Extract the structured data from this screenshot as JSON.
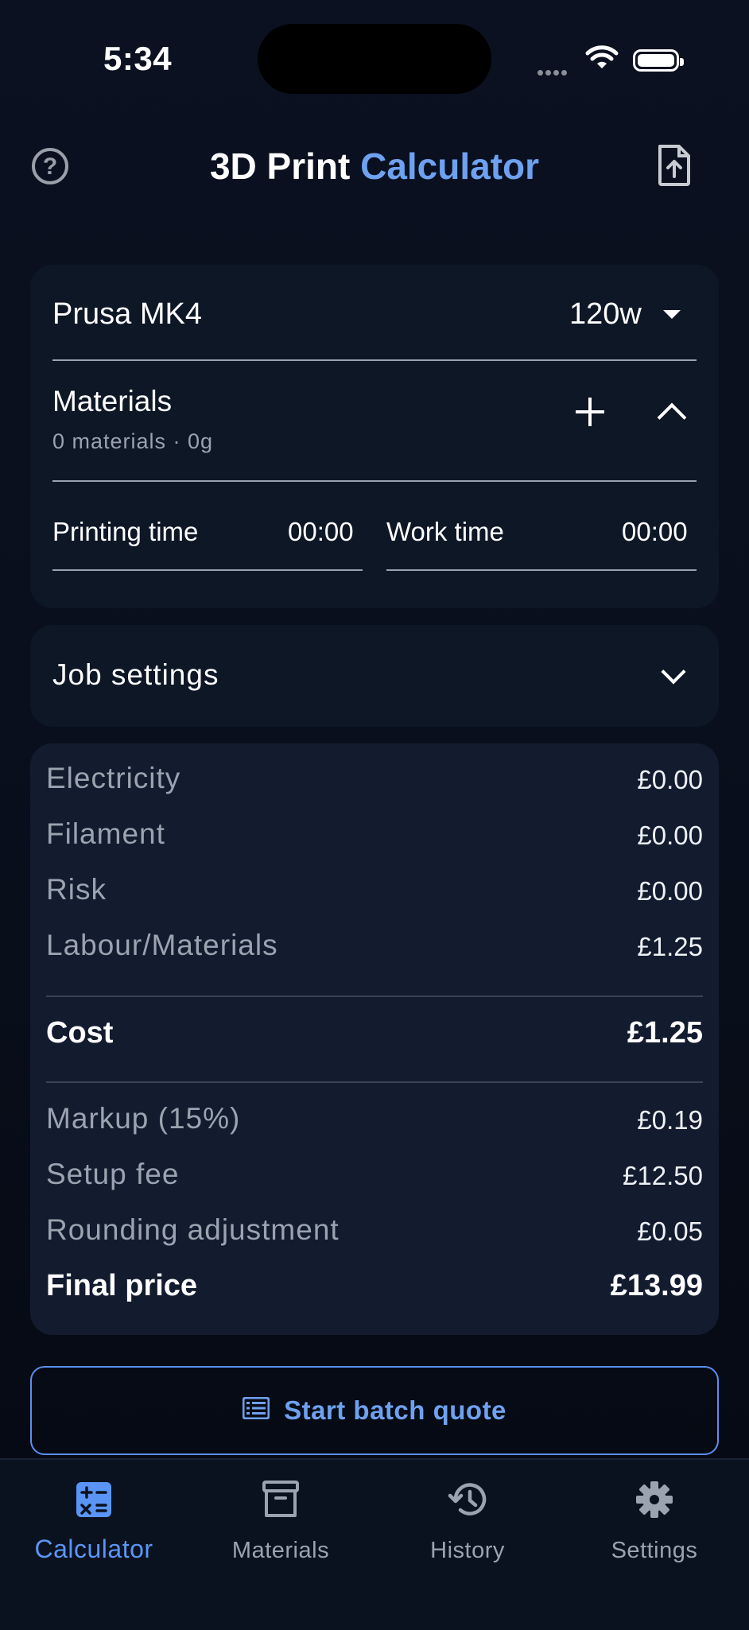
{
  "status_bar": {
    "time": "5:34"
  },
  "header": {
    "title_main": "3D Print",
    "title_accent": "Calculator"
  },
  "printer": {
    "name": "Prusa MK4",
    "power": "120w"
  },
  "materials": {
    "title": "Materials",
    "subtitle": "0 materials · 0g"
  },
  "times": {
    "printing_label": "Printing time",
    "printing_value": "00:00",
    "work_label": "Work time",
    "work_value": "00:00"
  },
  "job_settings": {
    "label": "Job settings"
  },
  "costs": {
    "rows": [
      {
        "label": "Electricity",
        "value": "£0.00"
      },
      {
        "label": "Filament",
        "value": "£0.00"
      },
      {
        "label": "Risk",
        "value": "£0.00"
      },
      {
        "label": "Labour/Materials",
        "value": "£1.25"
      }
    ],
    "cost_label": "Cost",
    "cost_value": "£1.25",
    "extras": [
      {
        "label": "Markup (15%)",
        "value": "£0.19"
      },
      {
        "label": "Setup fee",
        "value": "£12.50"
      },
      {
        "label": "Rounding adjustment",
        "value": "£0.05"
      }
    ],
    "final_label": "Final price",
    "final_value": "£13.99"
  },
  "batch_button": {
    "label": "Start batch quote"
  },
  "tabs": [
    {
      "label": "Calculator",
      "icon": "calculator-icon",
      "active": true
    },
    {
      "label": "Materials",
      "icon": "archive-icon",
      "active": false
    },
    {
      "label": "History",
      "icon": "history-icon",
      "active": false
    },
    {
      "label": "Settings",
      "icon": "gear-icon",
      "active": false
    }
  ],
  "colors": {
    "accent": "#6ea1ef",
    "background": "#0b1120",
    "card": "#0e1726",
    "breakdown_card": "#131b2f"
  }
}
